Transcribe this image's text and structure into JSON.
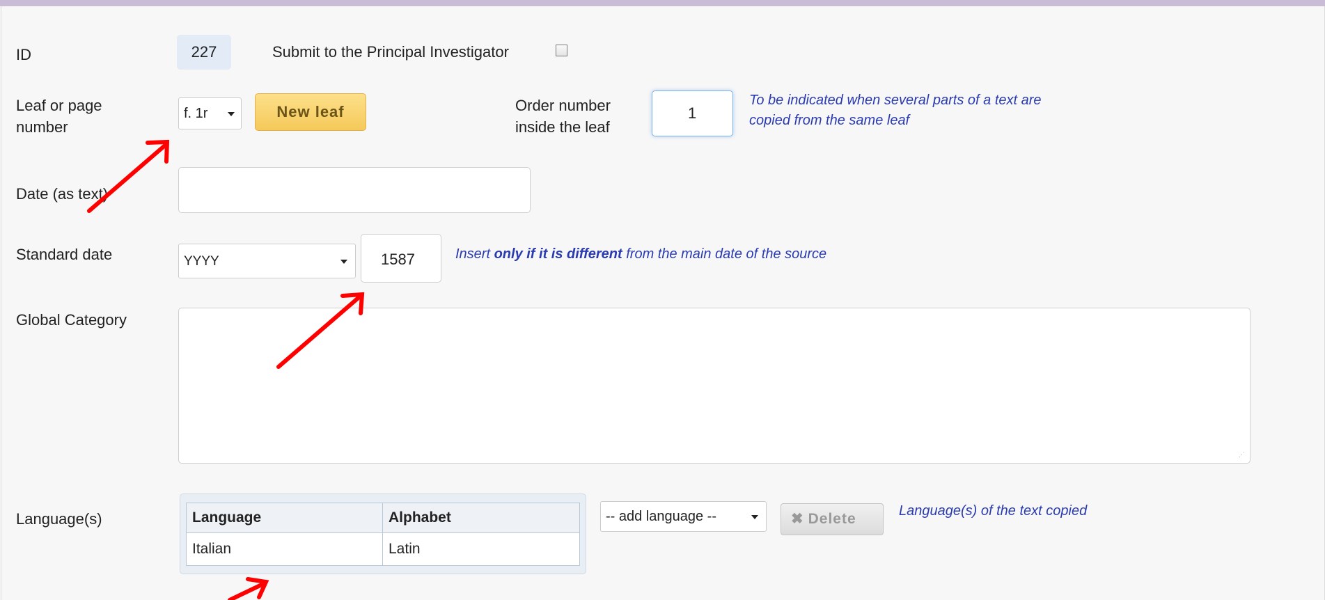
{
  "form": {
    "id_label": "ID",
    "id_value": "227",
    "submit_label": "Submit to the Principal Investigator",
    "submit_checked": false,
    "leaf_label": "Leaf or page number",
    "leaf_select_value": "f. 1r",
    "new_leaf_button": "New leaf",
    "order_label": "Order number inside the leaf",
    "order_value": "1",
    "order_hint": "To be indicated when several parts of a text are copied from the same leaf",
    "date_text_label": "Date (as text)",
    "date_text_value": "",
    "standard_date_label": "Standard date",
    "standard_date_select": "YYYY",
    "standard_date_year": "1587",
    "standard_date_hint_prefix": "Insert ",
    "standard_date_hint_bold": "only if it is different",
    "standard_date_hint_suffix": " from the main date of the source",
    "global_category_label": "Global Category",
    "global_category_value": "",
    "languages_label": "Language(s)",
    "languages_table": {
      "headers": [
        "Language",
        "Alphabet"
      ],
      "rows": [
        [
          "Italian",
          "Latin"
        ]
      ]
    },
    "add_language_select": "-- add language --",
    "delete_button": "Delete",
    "languages_hint": "Language(s) of the text copied"
  },
  "colors": {
    "hint": "#2a3bb0",
    "new_leaf_bg": "#f5c95a",
    "annotation_arrow": "#ff0000",
    "top_bar": "#c8bcd6"
  }
}
